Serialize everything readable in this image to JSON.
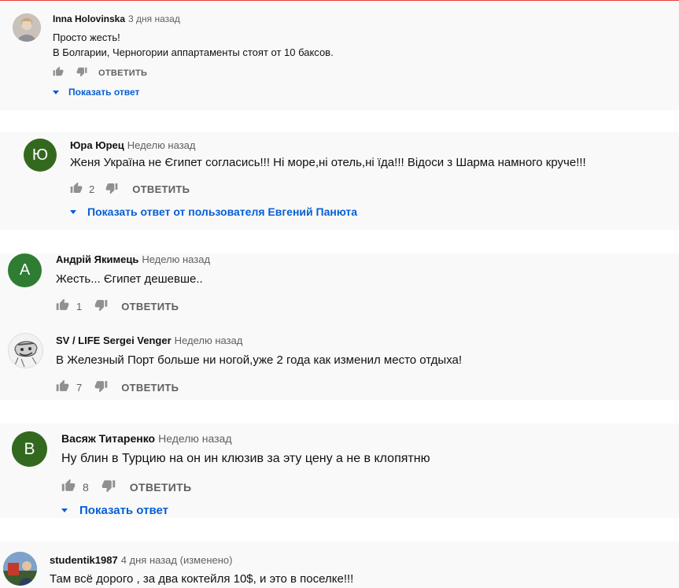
{
  "comments": [
    {
      "author": "Inna Holovinska",
      "time": "3 дня назад",
      "lines": [
        "Просто жесть!",
        "В Болгарии, Черногории аппартаменты стоят от 10 баксов."
      ],
      "likes": "",
      "reply_label": "ОТВЕТИТЬ",
      "show_replies": "Показать ответ",
      "avatar": {
        "type": "photo",
        "icon": "user-photo"
      }
    },
    {
      "author": "Юра Юрец",
      "time": "Неделю назад",
      "lines": [
        "Женя Україна не Єгипет согласись!!! Ні море,ні отель,ні їда!!! Відоси з Шарма намного круче!!!"
      ],
      "likes": "2",
      "reply_label": "ОТВЕТИТЬ",
      "show_replies": "Показать ответ от пользователя Евгений Панюта",
      "avatar": {
        "type": "letter",
        "letter": "Ю",
        "color": "#33691e"
      }
    },
    {
      "author": "Андрій Якимець",
      "time": "Неделю назад",
      "lines": [
        "Жесть... Єгипет дешевше.."
      ],
      "likes": "1",
      "reply_label": "ОТВЕТИТЬ",
      "avatar": {
        "type": "letter",
        "letter": "А",
        "color": "#2e7d32"
      }
    },
    {
      "author": "SV / LIFE Sergei Venger",
      "time": "Неделю назад",
      "lines": [
        "В Железный Порт больше ни ногой,уже 2 года как изменил место отдыха!"
      ],
      "likes": "7",
      "reply_label": "ОТВЕТИТЬ",
      "avatar": {
        "type": "sketch",
        "icon": "cartoon-avatar"
      }
    },
    {
      "author": "Васяж Титаренко",
      "time": "Неделю назад",
      "lines": [
        "Ну блин в Турцию на он ин клюзив за эту цену а не в клопятню"
      ],
      "likes": "8",
      "reply_label": "ОТВЕТИТЬ",
      "show_replies": "Показать ответ",
      "avatar": {
        "type": "letter",
        "letter": "В",
        "color": "#33691e"
      }
    },
    {
      "author": "studentik1987",
      "time": "4 дня назад (изменено)",
      "lines": [
        "Там всё дорого , за два коктейля 10$, и это в поселке!!!"
      ],
      "avatar": {
        "type": "photo",
        "icon": "user-photo"
      }
    }
  ],
  "colors": {
    "link": "#065fd4",
    "muted": "#606060",
    "icon": "#909090",
    "band": "#f9f9f9"
  }
}
